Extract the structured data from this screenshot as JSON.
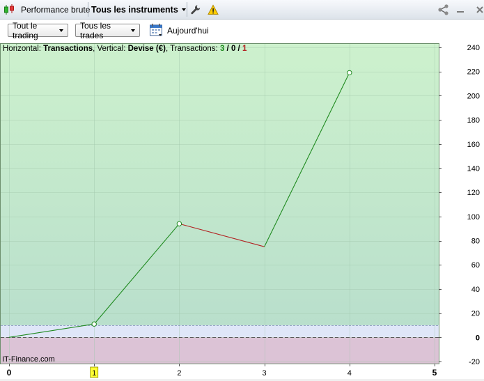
{
  "titlebar": {
    "title": "Performance brute",
    "instrument_selector": "Tous les instruments"
  },
  "toolbar": {
    "period_selector": "Tout le trading",
    "trades_selector": "Tous les trades",
    "today_label": "Aujourd'hui"
  },
  "info_bar": {
    "horizontal_label": "Horizontal: ",
    "horizontal_value": "Transactions",
    "vertical_label": ", Vertical: ",
    "vertical_value": "Devise (€)",
    "transactions_label": ", Transactions: ",
    "count_winning": "3",
    "slash1": " / ",
    "count_neutral": "0",
    "slash2": " / ",
    "count_losing": "1"
  },
  "watermark": "IT-Finance.com",
  "colors": {
    "gain_line": "#1f8a1f",
    "loss_line": "#b22222",
    "positive_zone": "#c9eccc",
    "negative_zone": "#dcc3d6",
    "threshold_band": "#dfe6f8"
  },
  "chart_data": {
    "type": "line",
    "x": [
      0,
      1,
      2,
      3,
      4
    ],
    "y": [
      0,
      11,
      94,
      75,
      219
    ],
    "segment_result": [
      "gain",
      "gain",
      "loss",
      "gain"
    ],
    "xlim": [
      0,
      5
    ],
    "ylim": [
      -20,
      240
    ],
    "x_ticks": [
      0,
      1,
      2,
      3,
      4,
      5
    ],
    "y_ticks": [
      -20,
      0,
      20,
      40,
      60,
      80,
      100,
      120,
      140,
      160,
      180,
      200,
      220,
      240
    ],
    "highlighted_x_tick": 1,
    "threshold_value": 10,
    "y_axis_side": "right",
    "grid": true
  }
}
